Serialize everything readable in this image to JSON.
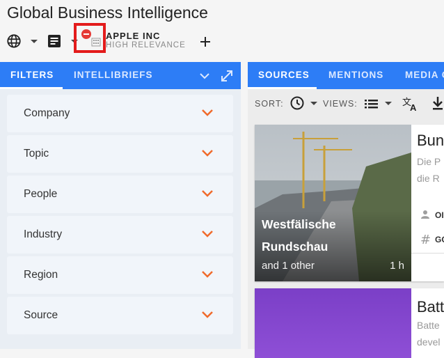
{
  "app": {
    "title": "Global Business Intelligence"
  },
  "toolbar": {
    "entity_name": "APPLE INC",
    "entity_relevance": "HIGH RELEVANCE",
    "icons": [
      "globe-icon",
      "chevron-down-icon",
      "document-icon",
      "remove-icon",
      "building-icon",
      "plus-icon"
    ]
  },
  "left": {
    "tabs": [
      "FILTERS",
      "INTELLIBRIEFS"
    ],
    "filters": [
      "Company",
      "Topic",
      "People",
      "Industry",
      "Region",
      "Source"
    ]
  },
  "right": {
    "tabs": [
      "SOURCES",
      "MENTIONS",
      "MEDIA C"
    ],
    "sort_label": "SORT:",
    "views_label": "VIEWS:",
    "cards": [
      {
        "source": "Westfälische",
        "source2": "Rundschau",
        "others": "and 1 other",
        "age": "1 h",
        "headline": "Bun",
        "snippet1": "Die P",
        "snippet2": "die R",
        "meta1": "OI",
        "meta2": "GC"
      },
      {
        "headline": "Batt",
        "snippet1": "Batte",
        "snippet2": "devel"
      }
    ]
  },
  "colors": {
    "accent": "#2d7df6",
    "chevron": "#f06a2b",
    "highlight": "#e31b1b"
  }
}
